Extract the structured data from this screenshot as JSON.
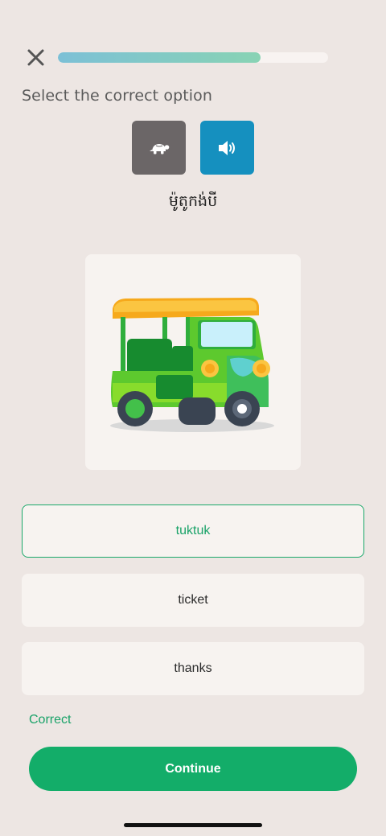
{
  "header": {
    "close_icon": "close-icon",
    "progress": 0.75,
    "progress_colors": [
      "#7cc0d6",
      "#88d3b4"
    ]
  },
  "question": {
    "prompt": "Select the correct option",
    "slow_audio_icon": "turtle-icon",
    "audio_icon": "speaker-icon",
    "word": "ម៉ូតូកង់បី",
    "image_icon": "tuktuk-illustration"
  },
  "options": [
    {
      "label": "tuktuk",
      "selected": true
    },
    {
      "label": "ticket",
      "selected": false
    },
    {
      "label": "thanks",
      "selected": false
    }
  ],
  "feedback": {
    "text": "Correct",
    "color": "#19a268"
  },
  "continue_label": "Continue",
  "colors": {
    "accent": "#13ad69",
    "audio_button": "#1590bf",
    "slow_button": "#6b6667",
    "background": "#ede6e3"
  }
}
